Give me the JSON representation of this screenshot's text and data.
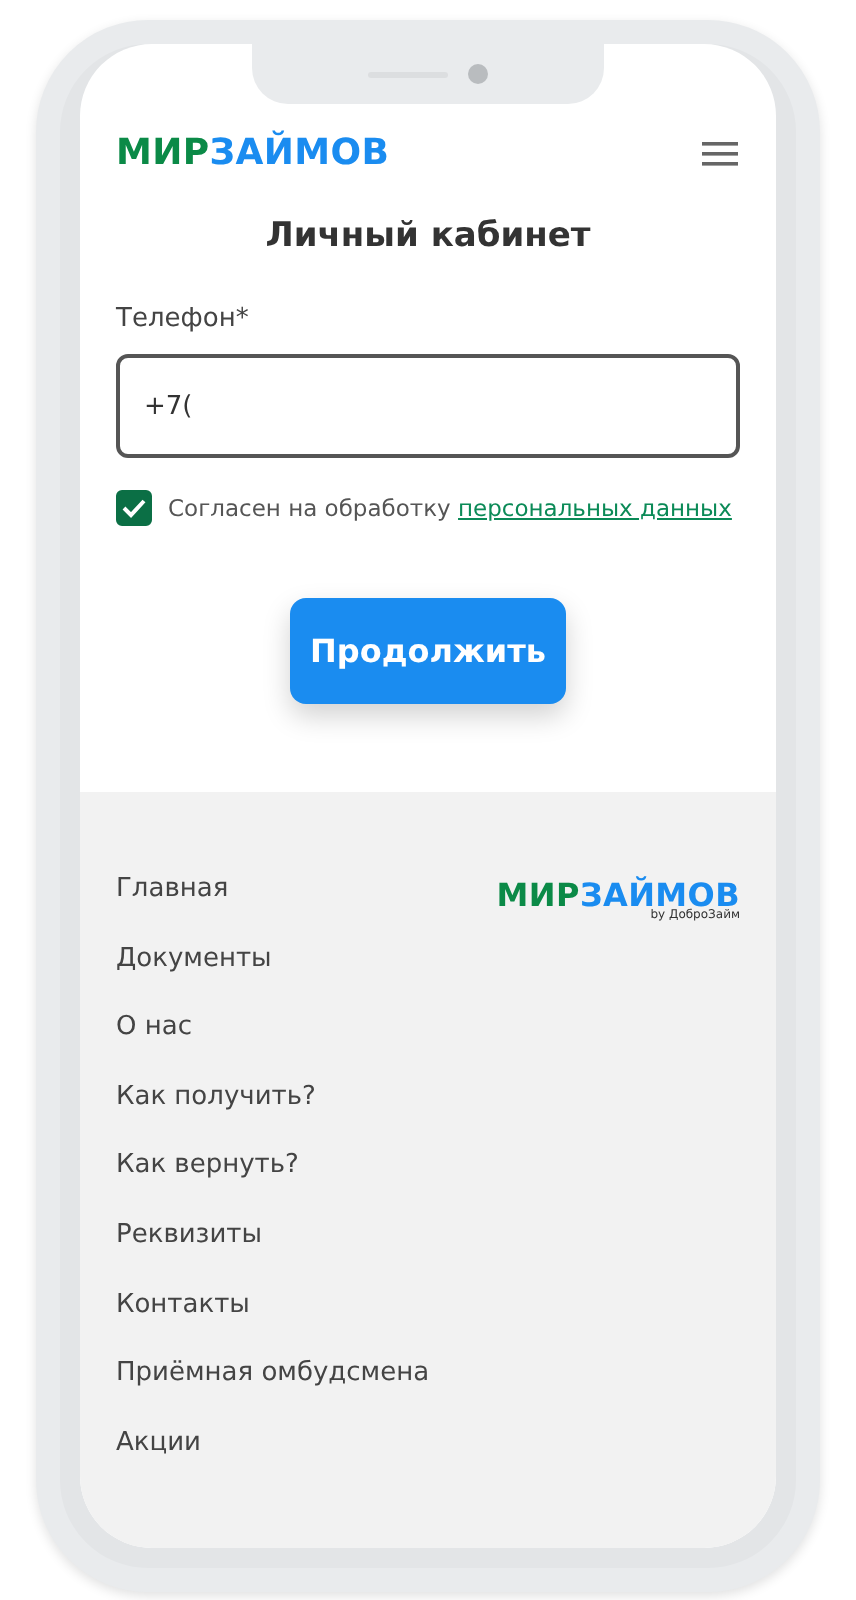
{
  "header": {
    "logo": {
      "part_1": "МИР",
      "part_2": "ЗАЙМОВ"
    }
  },
  "title": "Личный кабинет",
  "phone_field": {
    "label": "Телефон",
    "required_mark": "*",
    "value": "+7("
  },
  "consent": {
    "checked": true,
    "text": "Согласен на обработку",
    "link": "персональных данных"
  },
  "submit": "Продолжить",
  "footer": {
    "logo": {
      "part_1": "МИР",
      "part_2": "ЗАЙМОВ",
      "byline": "by ДоброЗайм"
    },
    "nav": [
      {
        "label": "Главная"
      },
      {
        "label": "Документы"
      },
      {
        "label": "О нас"
      },
      {
        "label": "Как получить?"
      },
      {
        "label": "Как вернуть?"
      },
      {
        "label": "Реквизиты"
      },
      {
        "label": "Контакты"
      },
      {
        "label": "Приёмная омбудсмена"
      },
      {
        "label": "Акции"
      }
    ]
  }
}
